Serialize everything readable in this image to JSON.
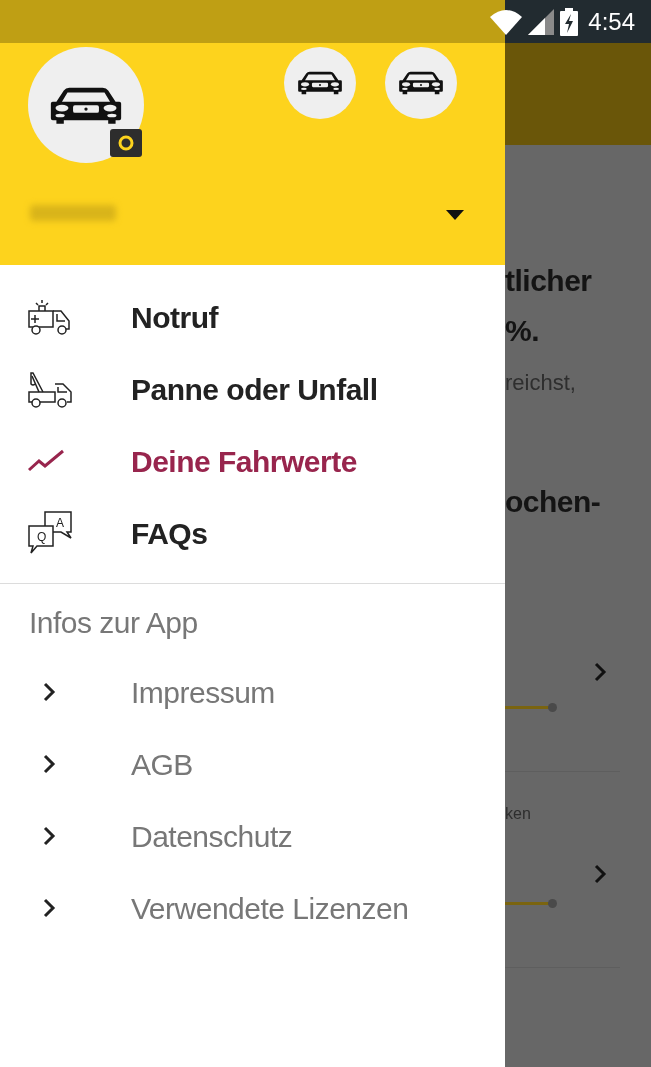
{
  "status_bar": {
    "time": "4:54"
  },
  "menu": [
    {
      "label": "Notruf",
      "kind": "ambulance",
      "selected": false
    },
    {
      "label": "Panne oder Unfall",
      "kind": "tow-truck",
      "selected": false
    },
    {
      "label": "Deine Fahrwerte",
      "kind": "trend",
      "selected": true
    },
    {
      "label": "FAQs",
      "kind": "chat",
      "selected": false,
      "icon_text": [
        "Q",
        "A"
      ]
    }
  ],
  "section_title": "Infos zur App",
  "links": [
    {
      "label": "Impressum"
    },
    {
      "label": "AGB"
    },
    {
      "label": "Datenschutz"
    },
    {
      "label": "Verwendete Lizenzen"
    }
  ],
  "background": {
    "headline": [
      "tlicher",
      "%."
    ],
    "body": "reichst,",
    "subheadline": "ochen-",
    "card_label": "ken"
  }
}
